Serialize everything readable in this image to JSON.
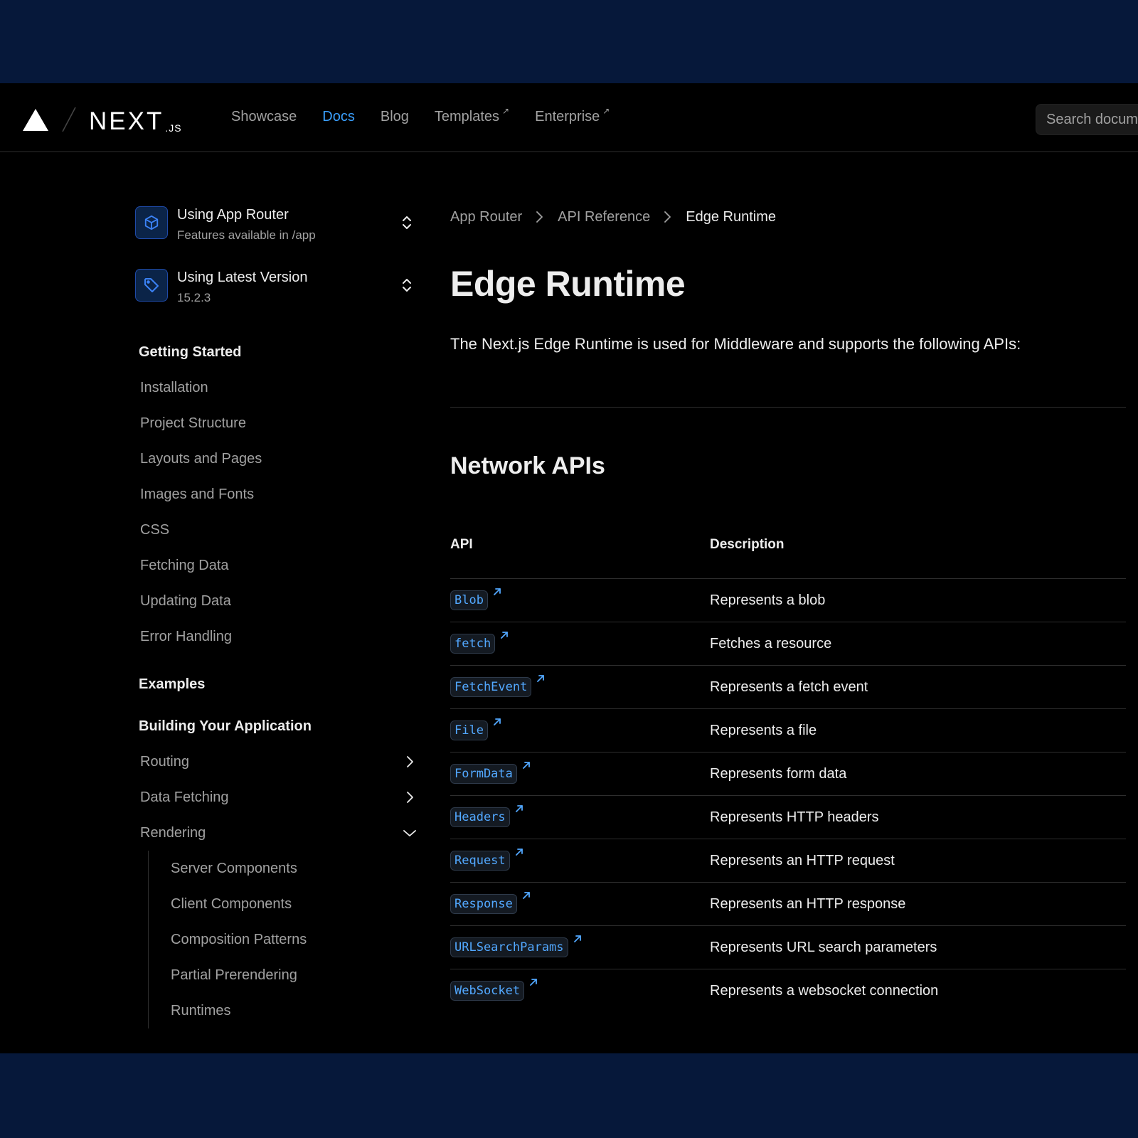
{
  "header": {
    "brand": "NEXT",
    "brand_suffix": ".JS",
    "nav": [
      {
        "label": "Showcase",
        "external": false,
        "active": false
      },
      {
        "label": "Docs",
        "external": false,
        "active": true
      },
      {
        "label": "Blog",
        "external": false,
        "active": false
      },
      {
        "label": "Templates",
        "external": true,
        "active": false
      },
      {
        "label": "Enterprise",
        "external": true,
        "active": false
      }
    ],
    "external_glyph": "↗",
    "search_placeholder": "Search documentation..."
  },
  "sidebar": {
    "router_switcher": {
      "title": "Using App Router",
      "subtitle": "Features available in /app",
      "icon": "cube-icon"
    },
    "version_switcher": {
      "title": "Using Latest Version",
      "subtitle": "15.2.3",
      "icon": "tag-icon"
    },
    "getting_started": {
      "heading": "Getting Started",
      "items": [
        "Installation",
        "Project Structure",
        "Layouts and Pages",
        "Images and Fonts",
        "CSS",
        "Fetching Data",
        "Updating Data",
        "Error Handling"
      ]
    },
    "examples_heading": "Examples",
    "building": {
      "heading": "Building Your Application",
      "items": [
        {
          "label": "Routing",
          "state": "collapsed"
        },
        {
          "label": "Data Fetching",
          "state": "collapsed"
        },
        {
          "label": "Rendering",
          "state": "expanded"
        }
      ],
      "rendering_children": [
        "Server Components",
        "Client Components",
        "Composition Patterns",
        "Partial Prerendering",
        "Runtimes"
      ]
    }
  },
  "main": {
    "breadcrumbs": [
      "App Router",
      "API Reference",
      "Edge Runtime"
    ],
    "title": "Edge Runtime",
    "intro": "The Next.js Edge Runtime is used for Middleware and supports the following APIs:",
    "section_title": "Network APIs",
    "table": {
      "headers": [
        "API",
        "Description"
      ],
      "rows": [
        {
          "api": "Blob",
          "description": "Represents a blob"
        },
        {
          "api": "fetch",
          "description": "Fetches a resource"
        },
        {
          "api": "FetchEvent",
          "description": "Represents a fetch event"
        },
        {
          "api": "File",
          "description": "Represents a file"
        },
        {
          "api": "FormData",
          "description": "Represents form data"
        },
        {
          "api": "Headers",
          "description": "Represents HTTP headers"
        },
        {
          "api": "Request",
          "description": "Represents an HTTP request"
        },
        {
          "api": "Response",
          "description": "Represents an HTTP response"
        },
        {
          "api": "URLSearchParams",
          "description": "Represents URL search parameters"
        },
        {
          "api": "WebSocket",
          "description": "Represents a websocket connection"
        }
      ]
    }
  },
  "colors": {
    "frame": "#06183a",
    "background": "#000000",
    "accent": "#3aa0ff",
    "code_text": "#52a8ff",
    "muted_text": "#a1a1a1",
    "border": "#2e2e2e"
  }
}
